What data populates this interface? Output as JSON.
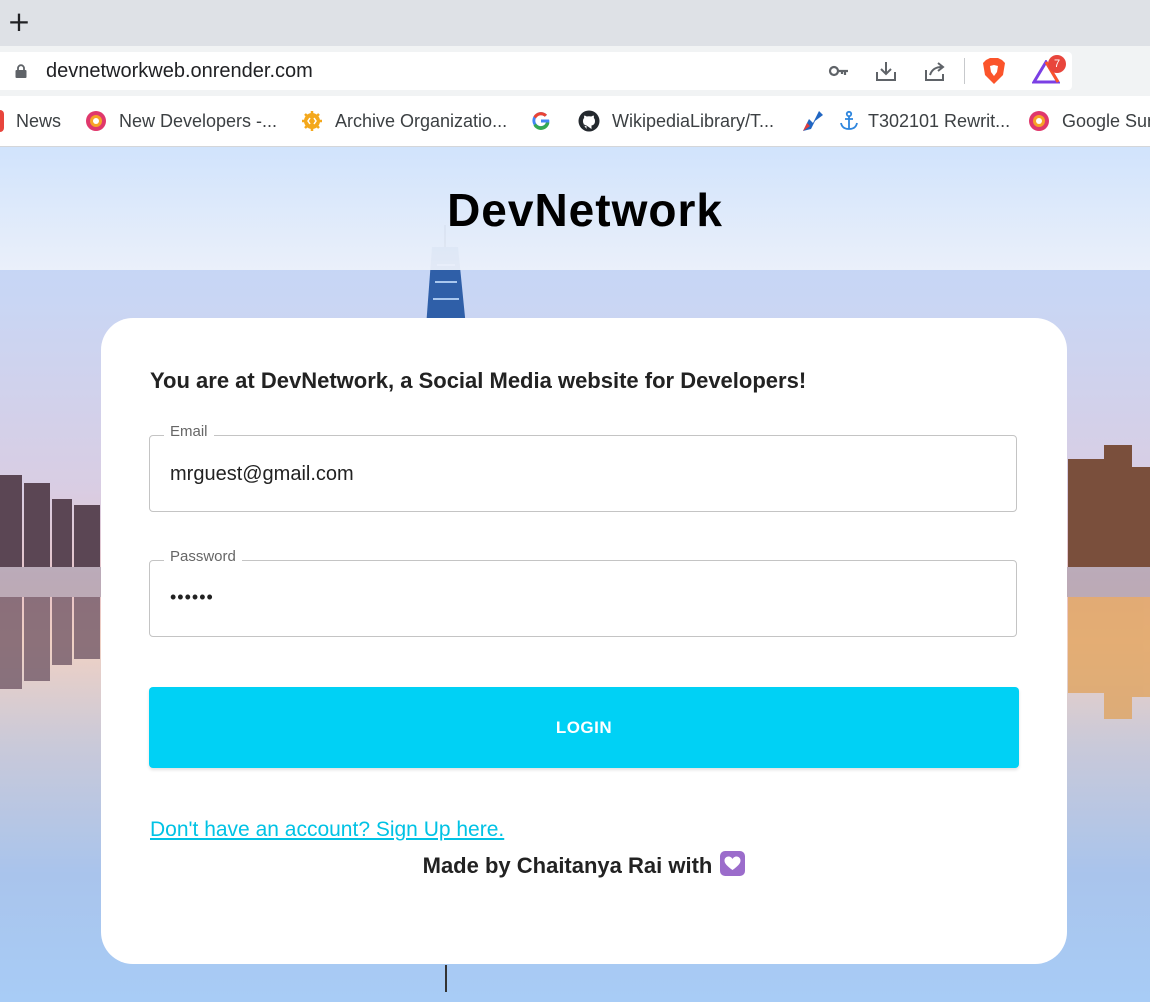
{
  "browser": {
    "new_tab_symbol": "+",
    "url": "devnetworkweb.onrender.com",
    "toolbar_icons": [
      "key-icon",
      "download-icon",
      "share-icon",
      "brave-shields-icon",
      "brave-rewards-icon"
    ],
    "rewards_badge": "7",
    "bookmarks": [
      {
        "label": "News",
        "icon": "news-icon"
      },
      {
        "label": "New Developers -...",
        "icon": "mediawiki-icon"
      },
      {
        "label": "Archive Organizatio...",
        "icon": "sourceforge-icon"
      },
      {
        "label": "",
        "icon": "google-icon"
      },
      {
        "label": "WikipediaLibrary/T...",
        "icon": "github-icon"
      },
      {
        "label": "",
        "icon": "phabricator-icon"
      },
      {
        "label": "T302101 Rewrit...",
        "icon": "anchor-icon"
      },
      {
        "label": "Google Sun",
        "icon": "mediawiki-icon"
      }
    ]
  },
  "page": {
    "brand": "DevNetwork",
    "intro": "You are at DevNetwork, a Social Media website for Developers!",
    "email": {
      "label": "Email",
      "value": "mrguest@gmail.com"
    },
    "password": {
      "label": "Password",
      "value": "••••••"
    },
    "login_label": "LOGIN",
    "signup_link": "Don't have an account? Sign Up here.",
    "made_by": "Made by Chaitanya Rai with",
    "colors": {
      "accent": "#00d1f5",
      "heart": "#9b6ccb"
    }
  }
}
